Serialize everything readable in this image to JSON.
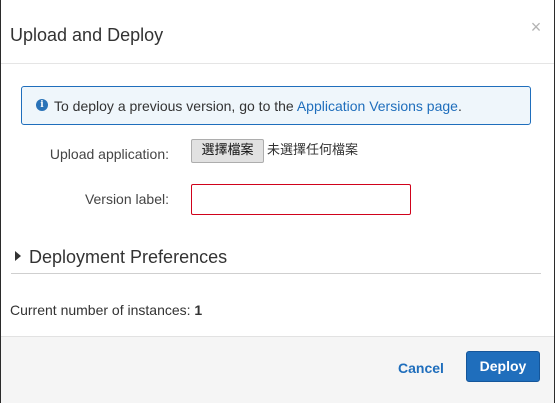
{
  "dialog": {
    "title": "Upload and Deploy",
    "close_label": "×"
  },
  "info": {
    "icon": "info-icon",
    "icon_glyph": "i",
    "text": "To deploy a previous version, go to the ",
    "link_text": "Application Versions page",
    "suffix": "."
  },
  "upload": {
    "label": "Upload application:",
    "button_label": "選擇檔案",
    "status_text": "未選擇任何檔案"
  },
  "version": {
    "label": "Version label:",
    "value": "",
    "placeholder": ""
  },
  "deployment_preferences": {
    "title": "Deployment Preferences",
    "expanded": false
  },
  "instances": {
    "label": "Current number of instances: ",
    "count": "1"
  },
  "footer": {
    "cancel_label": "Cancel",
    "deploy_label": "Deploy"
  },
  "colors": {
    "accent": "#1f6ebc",
    "info_background": "#eff6fb",
    "error_border": "#d0021b",
    "footer_background": "#f5f5f5"
  }
}
